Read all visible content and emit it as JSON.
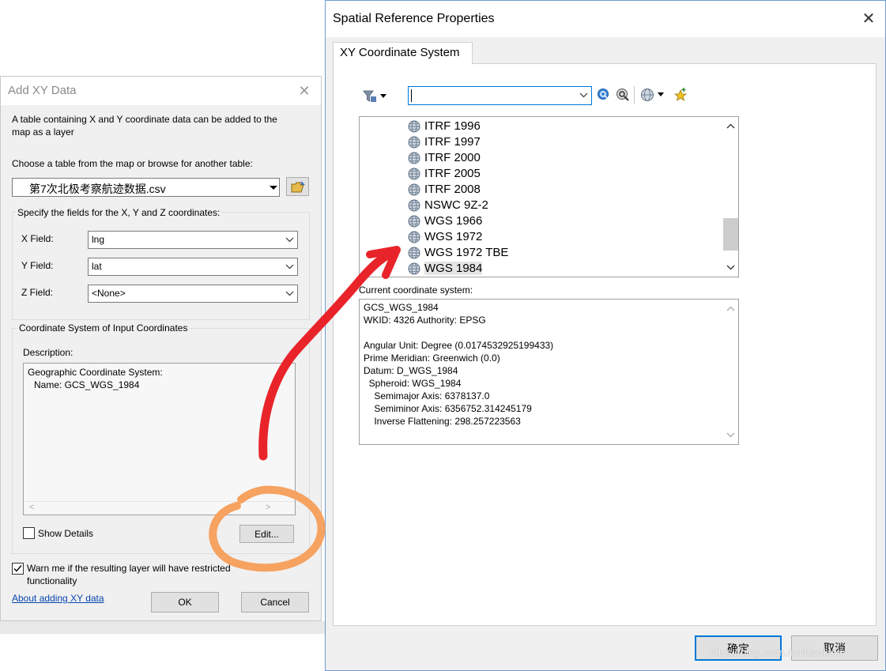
{
  "add_xy": {
    "title": "Add XY Data",
    "intro_line1": "A table containing X and Y coordinate data can be added to the",
    "intro_line2": "map as a layer",
    "choose_label": "Choose a table from the map or browse for another table:",
    "table_value": "第7次北极考察航迹数据.csv",
    "fields_group": "Specify the fields for the X, Y and Z coordinates:",
    "x_label": "X Field:",
    "x_value": "lng",
    "y_label": "Y Field:",
    "y_value": "lat",
    "z_label": "Z Field:",
    "z_value": "<None>",
    "coord_group": "Coordinate System of Input Coordinates",
    "description_label": "Description:",
    "description_line1": "Geographic Coordinate System:",
    "description_line2": "Name: GCS_WGS_1984",
    "show_details": "Show Details",
    "show_details_checked": false,
    "edit_button": "Edit...",
    "warn_line1": "Warn me if the resulting layer will have restricted",
    "warn_line2": "functionality",
    "warn_checked": true,
    "about_link": "About adding XY data",
    "ok_button": "OK",
    "cancel_button": "Cancel"
  },
  "spatial_ref": {
    "title": "Spatial Reference Properties",
    "tab": "XY Coordinate System",
    "search_value": "",
    "list_items": [
      "ITRF 1996",
      "ITRF 1997",
      "ITRF 2000",
      "ITRF 2005",
      "ITRF 2008",
      "NSWC 9Z-2",
      "WGS 1966",
      "WGS 1972",
      "WGS 1972 TBE",
      "WGS 1984"
    ],
    "selected_item": "WGS 1984",
    "current_label": "Current coordinate system:",
    "current_lines": [
      "GCS_WGS_1984",
      "WKID: 4326 Authority: EPSG",
      "",
      "Angular Unit: Degree (0.0174532925199433)",
      "Prime Meridian: Greenwich (0.0)",
      "Datum: D_WGS_1984",
      "  Spheroid: WGS_1984",
      "    Semimajor Axis: 6378137.0",
      "    Semiminor Axis: 6356752.314245179",
      "    Inverse Flattening: 298.257223563"
    ],
    "ok_button": "确定",
    "cancel_button": "取消"
  },
  "watermark": "https://blog.csdn.net/hawktony",
  "colors": {
    "arrow": "#e8242a",
    "circle": "#f6a261",
    "link": "#0645ad",
    "focus_border": "#0078d7"
  },
  "icons": [
    "close-icon",
    "browse-folder-icon",
    "filter-icon",
    "search-icon",
    "clear-search-icon",
    "globe-icon",
    "add-favorite-icon",
    "chevron-down-icon"
  ]
}
